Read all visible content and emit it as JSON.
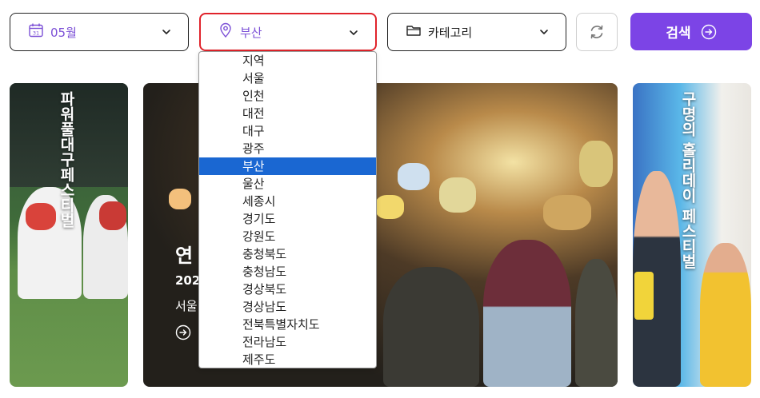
{
  "filters": {
    "month": {
      "value": "05월",
      "icon": "calendar-icon",
      "calendar_day": "31"
    },
    "region": {
      "value": "부산",
      "icon": "location-pin-icon"
    },
    "category": {
      "value": "카테고리",
      "icon": "folder-icon"
    }
  },
  "actions": {
    "refresh_icon": "refresh-icon",
    "search_label": "검색",
    "search_icon": "arrow-right-circle-icon",
    "accent": "#7c44e6"
  },
  "region_dropdown": {
    "selected_index": 6,
    "highlight_color": "#1a67d2",
    "options": [
      "지역",
      "서울",
      "인천",
      "대전",
      "대구",
      "광주",
      "부산",
      "울산",
      "세종시",
      "경기도",
      "강원도",
      "충청북도",
      "충청남도",
      "경상북도",
      "경상남도",
      "전북특별자치도",
      "전라남도",
      "제주도"
    ]
  },
  "cards": {
    "left": {
      "title": "파워풀대구페스티벌"
    },
    "center": {
      "title": "연",
      "date": "202",
      "place": "서울"
    },
    "right": {
      "title": "구명의 홀리데이 페스티벌"
    }
  }
}
